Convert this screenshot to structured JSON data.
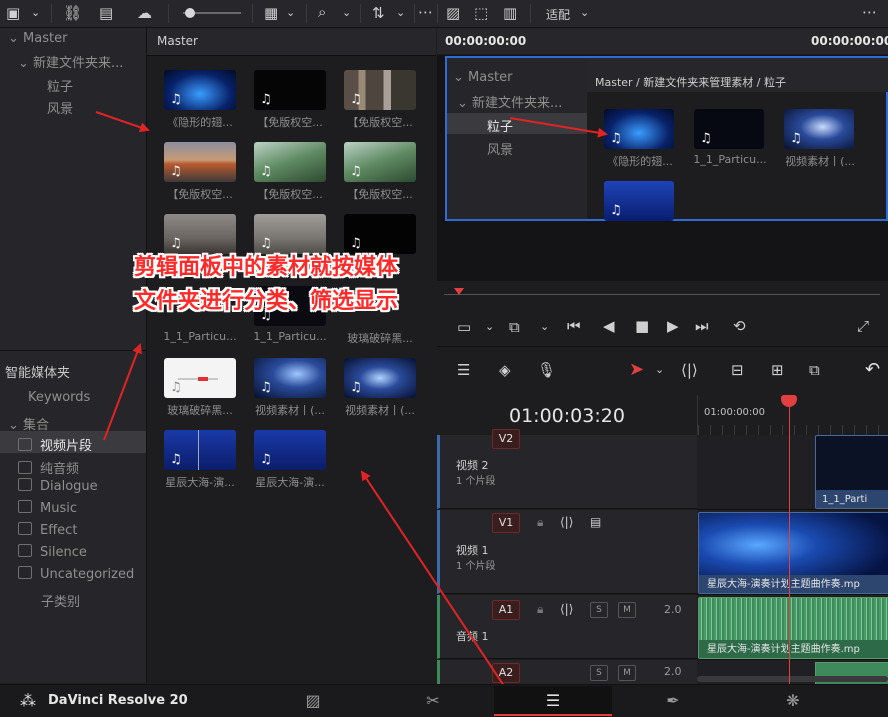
{
  "top_toolbar": {
    "fit_label": "适配"
  },
  "media_pool": {
    "tree": {
      "master": "Master",
      "folder": "新建文件夹来...",
      "sub1": "粒子",
      "sub2": "风景"
    },
    "header": "Master",
    "clips": [
      {
        "caption": "《隐形的翅..."
      },
      {
        "caption": "【免版权空..."
      },
      {
        "caption": "【免版权空..."
      },
      {
        "caption": "【免版权空..."
      },
      {
        "caption": "【免版权空..."
      },
      {
        "caption": "【免版权空..."
      },
      {
        "caption": ""
      },
      {
        "caption": ""
      },
      {
        "caption": ""
      },
      {
        "caption": "1_1_Particu..."
      },
      {
        "caption": "1_1_Particu..."
      },
      {
        "caption": "玻璃破碎黑..."
      },
      {
        "caption": "玻璃破碎黑..."
      },
      {
        "caption": "视频素材丨(..."
      },
      {
        "caption": "视频素材丨(..."
      },
      {
        "caption": "星辰大海-演..."
      },
      {
        "caption": "星辰大海-演..."
      }
    ],
    "smart_bins_title": "智能媒体夹",
    "keywords": "Keywords",
    "collections": "集合",
    "bins": [
      "视频片段",
      "纯音频",
      "Dialogue",
      "Music",
      "Effect",
      "Silence",
      "Uncategorized"
    ],
    "sub_category": "子类别"
  },
  "source_viewer": {
    "timecode_left": "00:00:00:00",
    "timecode_right": "00:00:00:00",
    "tree": {
      "master": "Master",
      "folder": "新建文件夹来...",
      "sub1": "粒子",
      "sub2": "风景"
    },
    "breadcrumb": "Master / 新建文件夹来管理素材 / 粒子",
    "clips": [
      {
        "caption": "《隐形的翅..."
      },
      {
        "caption": "1_1_Particu..."
      },
      {
        "caption": "视频素材丨(..."
      },
      {
        "caption": ""
      }
    ]
  },
  "annotation": {
    "line1": "剪辑面板中的素材就按媒体",
    "line2": "文件夹进行分类、筛选显示"
  },
  "timeline": {
    "timecode": "01:00:03:20",
    "ruler_label": "01:00:00:00",
    "tracks": [
      {
        "id": "V2",
        "name": "视频 2",
        "clips": "1 个片段"
      },
      {
        "id": "V1",
        "name": "视频 1",
        "clips": "1 个片段"
      },
      {
        "id": "A1",
        "name": "音频 1",
        "level": "2.0"
      },
      {
        "id": "A2",
        "level": "2.0"
      }
    ],
    "clip_v2": "1_1_Parti",
    "clip_v1": "星辰大海-演奏计划主题曲作奏.mp",
    "clip_a1": "星辰大海-演奏计划主题曲作奏.mp"
  },
  "bottom_bar": {
    "app_name": "DaVinci Resolve 20"
  }
}
